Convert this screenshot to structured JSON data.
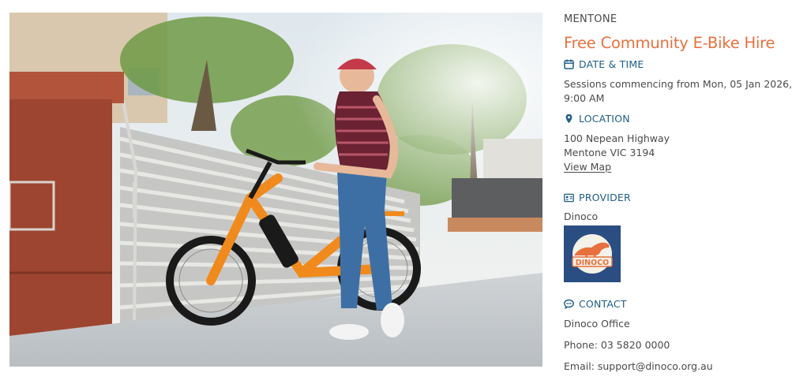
{
  "event": {
    "suburb": "MENTONE",
    "title": "Free Community E-Bike Hire"
  },
  "date_time": {
    "heading": "DATE & TIME",
    "icon": "calendar-icon",
    "line1": "Sessions commencing from Mon, 05 Jan 2026,",
    "line2": "9:00 AM"
  },
  "location": {
    "heading": "LOCATION",
    "icon": "map-pin-icon",
    "address_line1": "100 Nepean Highway",
    "address_line2": "Mentone VIC 3194",
    "map_link": "View Map"
  },
  "provider": {
    "heading": "PROVIDER",
    "icon": "id-card-icon",
    "name": "Dinoco",
    "logo_text": "DINOCO"
  },
  "contact": {
    "heading": "CONTACT",
    "icon": "chat-bubble-icon",
    "office": "Dinoco Office",
    "phone_label": "Phone: ",
    "phone": "03 5820 0000",
    "email_label": "Email: ",
    "email": "support@dinoco.org.au"
  },
  "colors": {
    "title": "#e8703f",
    "heading": "#1d5e86",
    "logo_bg": "#2a4d82",
    "logo_orange": "#e8703f"
  }
}
